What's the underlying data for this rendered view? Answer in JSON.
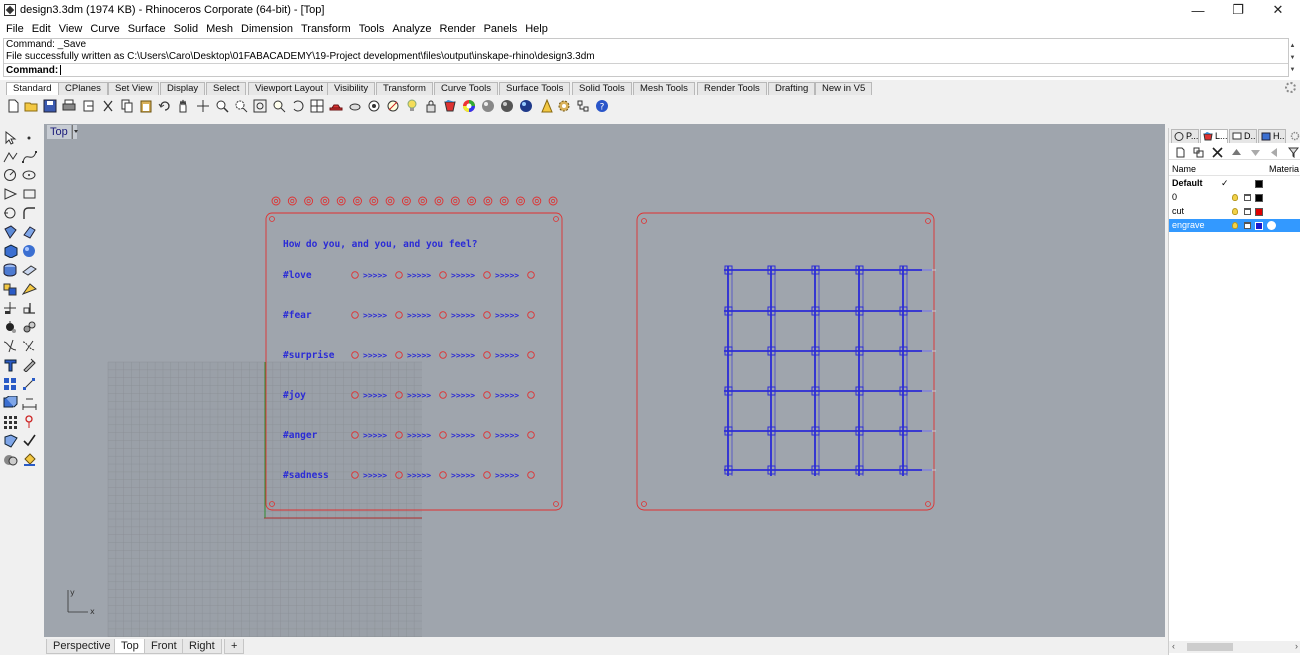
{
  "window": {
    "title": "design3.3dm (1974 KB) - Rhinoceros Corporate (64-bit) - [Top]",
    "controls": {
      "minimize": "—",
      "maximize": "❐",
      "close": "✕"
    }
  },
  "menu": [
    "File",
    "Edit",
    "View",
    "Curve",
    "Surface",
    "Solid",
    "Mesh",
    "Dimension",
    "Transform",
    "Tools",
    "Analyze",
    "Render",
    "Panels",
    "Help"
  ],
  "command": {
    "history": [
      "Command: _Save",
      "File successfully written as C:\\Users\\Caro\\Desktop\\01FABACADEMY\\19-Project development\\files\\output\\inskape-rhino\\design3.3dm"
    ],
    "prompt": "Command:",
    "input": ""
  },
  "toolbar_tabs": [
    "Standard",
    "CPlanes",
    "Set View",
    "Display",
    "Select",
    "Viewport Layout",
    "Visibility",
    "Transform",
    "Curve Tools",
    "Surface Tools",
    "Solid Tools",
    "Mesh Tools",
    "Render Tools",
    "Drafting",
    "New in V5"
  ],
  "viewport": {
    "title": "Top",
    "axis_y": "y",
    "axis_x": "x",
    "design_heading": "How do you, and you, and you feel?",
    "emotions": [
      "#love",
      "#fear",
      "#surprise",
      "#joy",
      "#anger",
      "#sadness"
    ],
    "arrow_text": ">>>>>",
    "colors": {
      "background": "#9fa5ad",
      "cut": "#e03030",
      "engrave": "#2b2bd6",
      "grid": "#8a8f96"
    }
  },
  "viewport_tabs": [
    "Perspective",
    "Top",
    "Front",
    "Right"
  ],
  "viewport_tabs_add": "+",
  "right_panel": {
    "tabs": [
      "P...",
      "L...",
      "D...",
      "H..."
    ],
    "columns": {
      "name": "Name",
      "material": "Materia"
    },
    "layers": [
      {
        "name": "Default",
        "current": "✓",
        "color": "#000000",
        "bold": true
      },
      {
        "name": "0",
        "color": "#000000"
      },
      {
        "name": "cut",
        "color": "#e00000"
      },
      {
        "name": "engrave",
        "color": "#1a1acc",
        "selected": true
      }
    ]
  }
}
